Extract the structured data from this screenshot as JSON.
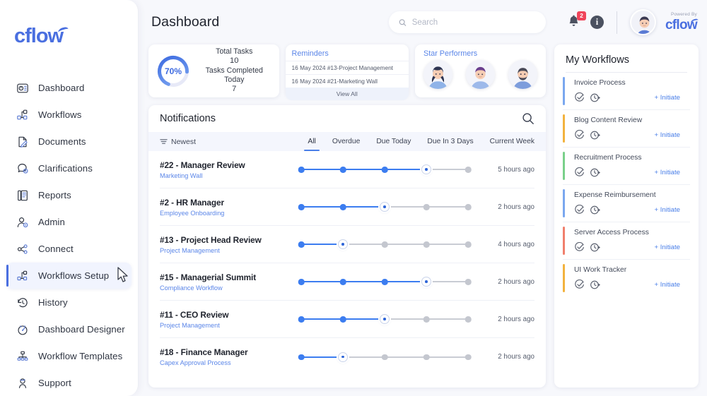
{
  "brand": {
    "logo": "cflow",
    "powered_by": "Powered By",
    "powered_logo": "cflow"
  },
  "sidebar": {
    "items": [
      {
        "label": "Dashboard",
        "icon": "dashboard-icon",
        "active": false
      },
      {
        "label": "Workflows",
        "icon": "workflows-icon",
        "active": false
      },
      {
        "label": "Documents",
        "icon": "documents-icon",
        "active": false
      },
      {
        "label": "Clarifications",
        "icon": "clarifications-icon",
        "active": false
      },
      {
        "label": "Reports",
        "icon": "reports-icon",
        "active": false
      },
      {
        "label": "Admin",
        "icon": "admin-icon",
        "active": false
      },
      {
        "label": "Connect",
        "icon": "connect-icon",
        "active": false
      },
      {
        "label": "Workflows Setup",
        "icon": "workflows-setup-icon",
        "active": true
      },
      {
        "label": "History",
        "icon": "history-icon",
        "active": false
      },
      {
        "label": "Dashboard Designer",
        "icon": "dashboard-designer-icon",
        "active": false
      },
      {
        "label": "Workflow Templates",
        "icon": "workflow-templates-icon",
        "active": false
      },
      {
        "label": "Support",
        "icon": "support-icon",
        "active": false
      }
    ]
  },
  "header": {
    "title": "Dashboard",
    "search_placeholder": "Search",
    "search_value": "",
    "notification_count": "2",
    "info_label": "i"
  },
  "cards": {
    "tasks": {
      "percent": "70%",
      "percent_value": 70,
      "total_label": "Total Tasks",
      "total_value": "10",
      "completed_label": "Tasks Completed Today",
      "completed_value": "7"
    },
    "reminders": {
      "title": "Reminders",
      "items": [
        "16 May 2024 #13-Project Management",
        "16 May 2024 #21-Marketing Wall"
      ],
      "view_all": "View All"
    },
    "star_performers": {
      "title": "Star Performers",
      "count": 3
    }
  },
  "notifications": {
    "title": "Notifications",
    "sort_label": "Newest",
    "tabs": [
      {
        "label": "All",
        "active": true
      },
      {
        "label": "Overdue",
        "active": false
      },
      {
        "label": "Due Today",
        "active": false
      },
      {
        "label": "Due In 3 Days",
        "active": false
      },
      {
        "label": "Current Week",
        "active": false
      }
    ],
    "rows": [
      {
        "title": "#22 - Manager Review",
        "workflow": "Marketing Wall",
        "steps": 5,
        "current": 4,
        "time": "5 hours ago"
      },
      {
        "title": "#2 - HR Manager",
        "workflow": "Employee Onboarding",
        "steps": 5,
        "current": 3,
        "time": "2 hours ago"
      },
      {
        "title": "#13 - Project Head Review",
        "workflow": "Project Management",
        "steps": 5,
        "current": 2,
        "time": "4 hours ago"
      },
      {
        "title": "#15 - Managerial Summit",
        "workflow": "Compliance Workflow",
        "steps": 5,
        "current": 4,
        "time": "2 hours ago"
      },
      {
        "title": "#11 - CEO Review",
        "workflow": "Project Management",
        "steps": 5,
        "current": 3,
        "time": "2 hours ago"
      },
      {
        "title": "#18 - Finance Manager",
        "workflow": "Capex Approval Process",
        "steps": 5,
        "current": 2,
        "time": "2 hours ago"
      }
    ]
  },
  "my_workflows": {
    "title": "My Workflows",
    "initiate_label": "+ Initiate",
    "items": [
      {
        "name": "Invoice Process",
        "color": "#7aa7ef"
      },
      {
        "name": "Blog Content Review",
        "color": "#f2b23e"
      },
      {
        "name": "Recruitment Process",
        "color": "#7ad08a"
      },
      {
        "name": "Expense Reimbursement",
        "color": "#7aa7ef"
      },
      {
        "name": "Server Access Process",
        "color": "#f07f6c"
      },
      {
        "name": "UI Work Tracker",
        "color": "#f2b23e"
      }
    ]
  },
  "colors": {
    "accent": "#4a6fe0",
    "progress_blue": "#3c7df0",
    "badge_red": "#f0445a",
    "background": "#f7f8fc"
  }
}
